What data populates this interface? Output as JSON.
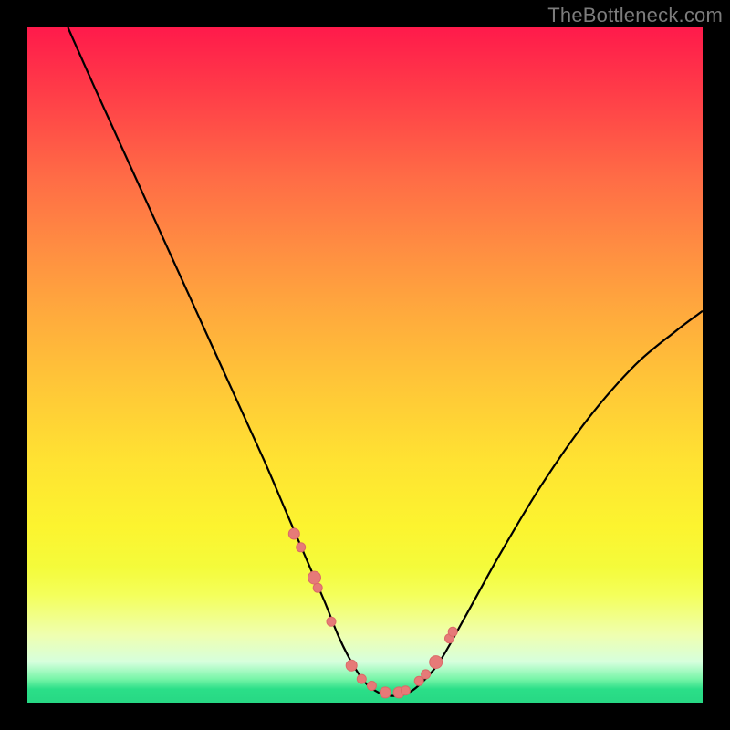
{
  "watermark": "TheBottleneck.com",
  "chart_data": {
    "type": "line",
    "title": "",
    "xlabel": "",
    "ylabel": "",
    "xlim": [
      0,
      100
    ],
    "ylim": [
      0,
      100
    ],
    "grid": false,
    "legend": false,
    "series": [
      {
        "name": "curve",
        "x": [
          6,
          10,
          15,
          20,
          25,
          30,
          35,
          38,
          41,
          44,
          46,
          48,
          50,
          52,
          54,
          56,
          58,
          61,
          65,
          70,
          76,
          83,
          90,
          96,
          100
        ],
        "y": [
          100,
          91,
          80,
          69,
          58,
          47,
          36,
          29,
          22,
          15,
          10,
          6,
          3,
          1.5,
          1,
          1.3,
          2.6,
          6,
          13,
          22,
          32,
          42,
          50,
          55,
          58
        ]
      }
    ],
    "markers": {
      "name": "dots",
      "x": [
        39.5,
        40.5,
        42.5,
        43,
        45,
        48,
        49.5,
        51,
        53,
        55,
        56,
        58,
        59,
        60.5,
        62.5,
        63
      ],
      "y": [
        25,
        23,
        18.5,
        17,
        12,
        5.5,
        3.5,
        2.5,
        1.5,
        1.5,
        1.8,
        3.2,
        4.2,
        6,
        9.5,
        10.5
      ],
      "r": [
        6,
        5,
        7,
        5,
        5,
        6,
        5,
        5,
        6,
        6,
        5,
        5,
        5,
        7,
        5,
        5
      ]
    }
  }
}
